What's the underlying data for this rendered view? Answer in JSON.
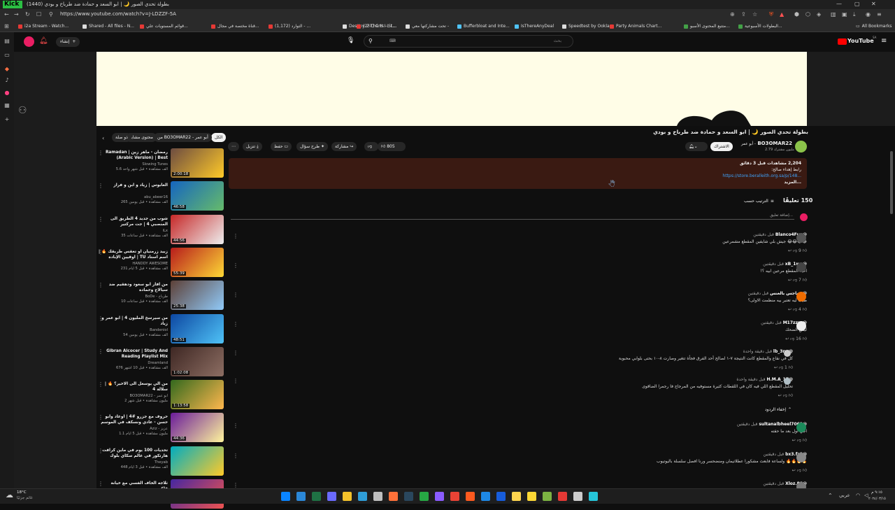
{
  "titlebar": {
    "app_badge": "Kick",
    "tab_title": "(1440) بطولة تحدي الصور 🌙 | ابو السعد و حمادة ضد طرباخ و بودي",
    "minimize": "—",
    "maximize": "▢",
    "close": "✕"
  },
  "addressbar": {
    "url": "https://www.youtube.com/watch?v=J-LDZZF-5A"
  },
  "bookmarks": [
    {
      "label": "i2a Stream - Watch...",
      "color": "#e53935"
    },
    {
      "label": "Shared - All files - N...",
      "color": "#ddd"
    },
    {
      "label": "قوائم المستويات علي...",
      "color": "#e53935"
    },
    {
      "label": "قناة مختصة في مجال...",
      "color": "#e53935"
    },
    {
      "label": "(1,172) التوارد - ...",
      "color": "#e53935"
    },
    {
      "label": "Destiny 2 Charts - St...",
      "color": "#ddd"
    },
    {
      "label": "(237) C H I L L...",
      "color": "#e53935"
    },
    {
      "label": "تحت مشاركتها معي -",
      "color": "#ddd"
    },
    {
      "label": "Bufferbloat and Inte...",
      "color": "#4fc3f7"
    },
    {
      "label": "IsThereAnyDeal",
      "color": "#4fc3f7"
    },
    {
      "label": "Speedtest by Ookla...",
      "color": "#ddd"
    },
    {
      "label": "Party Animals Chart...",
      "color": "#e53935"
    },
    {
      "label": "متتبع المحتوى الأسبو...",
      "color": "#43a047"
    },
    {
      "label": "البطولات الأسبوعية...",
      "color": "#43a047"
    }
  ],
  "all_bookmarks": "All Bookmarks",
  "header": {
    "create": "إنشاء",
    "search_placeholder": "بحث",
    "youtube": "YouTube",
    "sa": "SA"
  },
  "video": {
    "title": "بطولة تحدي الصور 🌙 | ابو السعد و حمادة ضد طرباخ و بودي",
    "channel": "BO3OMAR22",
    "channel_prefix": "أبو عمر -",
    "subs": "2.79 مليون مشترك",
    "subscribe": "الاشتراك",
    "likes": "805",
    "share": "مشاركة",
    "ask": "طرح سؤال",
    "save": "حفظ",
    "download": "تنزيل",
    "more": "⋯"
  },
  "description": {
    "views": "2,204 مشاهدات قبل 3 دقائق",
    "line2": "رابط إهداء صالح:",
    "link": "https://store.beralleith.org.sa/p/148...",
    "more": "...المزيد"
  },
  "comments_header": {
    "count": "150 تعليقًا",
    "sort": "الترتيب حسب",
    "add_placeholder": "إضافة تعليق..."
  },
  "comments": [
    {
      "user": "@Blanco4Fun",
      "ago": "قبل دقيقتين",
      "text": "😂😂😂😂 جيش بلي شايفين المقطع مشمرعين",
      "likes": "9"
    },
    {
      "user": "@xB_1we",
      "ago": "قبل دقيقتين",
      "text": "اخيد المقطع مرعين ابيه ؟!",
      "likes": "7"
    },
    {
      "user": "@يتهاجس بالغنس",
      "ago": "قبل دقيقتين",
      "text": "طيب ليه تعتبر بيه منظمت الاولى؟",
      "likes": "4"
    },
    {
      "user": "@M17zzzz",
      "ago": "قبل دقيقتين",
      "text": "ليش الضحك",
      "likes": "16"
    },
    {
      "user": "@lb_3ng",
      "ago": "قبل دقيقة واحدة",
      "text": "كل في نقاع والمقطع كانت النتيجة ٧-١ لصالح أحد الفرق فجأة تتغير وصارت ٨-١٠ بحتى بلوابي محبوبة",
      "likes": "1"
    },
    {
      "user": "@H.M.A_17",
      "ago": "قبل دقيقة واحدة",
      "text": "تحليل المقطع اللي فيه كان في اللقطات كثيرة مستوفيه من المرجاج فا رجمرا الضاقوى",
      "likes": ""
    },
    {
      "user": "@sultanalbheel7062",
      "ago": "قبل دقيقتين",
      "text": "اجي اول بعد ما حقته",
      "likes": ""
    },
    {
      "user": "@bx3.fz1",
      "ago": "قبل دقيقتين",
      "text": "🔥🔥🔥🔥 ولساعة فابعث مشكورا عطلاتيمان ومنضحسر ورنا افصل سلسلة باليوتيوب",
      "likes": ""
    },
    {
      "user": "@Xloz.88",
      "ago": "قبل دقيقتين",
      "text": "",
      "likes": ""
    }
  ],
  "hide_replies": "إخفاء الردود",
  "filter_chips": [
    "الكل",
    "من BO3OMAR22 - أبو عمر",
    "محتوى مشابه",
    "ذو صلة"
  ],
  "recommendations": [
    {
      "title": "رمضان - ماهر زين | Ramadan (Arabic Version) | Best Islamic...",
      "channel": "Slowing Tunes",
      "meta": "5.6 ألف مشاهدة • قبل شهر واحد",
      "dur": "2:00:18",
      "c1": "#6d4c41",
      "c2": "#ffca28"
    },
    {
      "title": "الغابوس | زياد و ابن و فراز",
      "channel": "abu_abeer16",
      "meta": "265 ألف مشاهدة • قبل يومين",
      "dur": "46:58",
      "c1": "#1565c0",
      "c2": "#66bb6a"
    },
    {
      "title": "شوب من جديد 4 الطريق الى المنصبي 4 | جت مركتير",
      "channel": "iLx",
      "meta": "35 ألف مشاهدة • قبل ساعات",
      "dur": "44:56",
      "c1": "#c62828",
      "c2": "#eeeeee"
    },
    {
      "title": "زبيد زرمنيان او تعقس طريقك 🔥 | اسم استاد TU | اوقيين الإبادة",
      "channel": "HANDDY AWESOME",
      "meta": "231 ألف مشاهدة • قبل 5 أيام",
      "dur": "55:39",
      "c1": "#b71c1c",
      "c2": "#fdd835"
    },
    {
      "title": "من افار ابو سعود ودهقيم ضد سيالاج وحمادة",
      "channel": "BoDe - طرباخ",
      "meta": "10 ألف مشاهدة • قبل ساعات",
      "dur": "25:38",
      "c1": "#5d4037",
      "c2": "#90caf9"
    },
    {
      "title": "من سيرسخ المليون 4 | ابو عمر و زياد",
      "channel": "Bandeniol",
      "meta": "54 ألف مشاهدة • قبل يومين",
      "dur": "48:51",
      "c1": "#0d47a1",
      "c2": "#4fc3f7"
    },
    {
      "title": "Gibran Alcocer | Study And Reading Playlist Mix",
      "channel": "Dreamland",
      "meta": "676 ألف مشاهدة • قبل 10 أشهر",
      "dur": "1:02:08",
      "c1": "#3e2723",
      "c2": "#8d6e63"
    },
    {
      "title": "من الي يوسعل الى الاخير؟ 🔥 | سلالة 4",
      "channel": "BO3OMAR22 - أبو عمر",
      "meta": "2 مليون مشاهدة • قبل شهر",
      "dur": "1:13:58",
      "c1": "#33691e",
      "c2": "#ffb74d"
    },
    {
      "title": "حروف مع جزرو #4 | اوعاد وابو حسن - عادي ونسكف في الموسم الثالث",
      "channel": "Aziz - عزيز",
      "meta": "1.1 مليون مشاهدة • قبل 5 أيام",
      "dur": "44:36",
      "c1": "#6a1b9a",
      "c2": "#fff59d"
    },
    {
      "title": "تحديات 100 يوم في ماين كرافت هارتكور في عالم سكاي بلوك",
      "channel": "Theyab",
      "meta": "448 ألف مشاهدة • قبل 3 أيام",
      "dur": "",
      "c1": "#00acc1",
      "c2": "#ffca28"
    },
    {
      "title": "ثلاجه الخاف الفسي مع خيانة فلكيور",
      "channel": "",
      "meta": "",
      "dur": "",
      "c1": "#4527a0",
      "c2": "#ef5350"
    }
  ],
  "taskbar": {
    "weather_temp": "18°C",
    "weather_desc": "غائم جزئيًا",
    "time": "٩:١٥ م",
    "date": "٢٠٢٤/٠٣/١٥",
    "lang": "عربي"
  },
  "colors": {
    "desc_bg": "#3a1a12",
    "yt_red": "#ff0000",
    "link": "#3ea6ff"
  }
}
